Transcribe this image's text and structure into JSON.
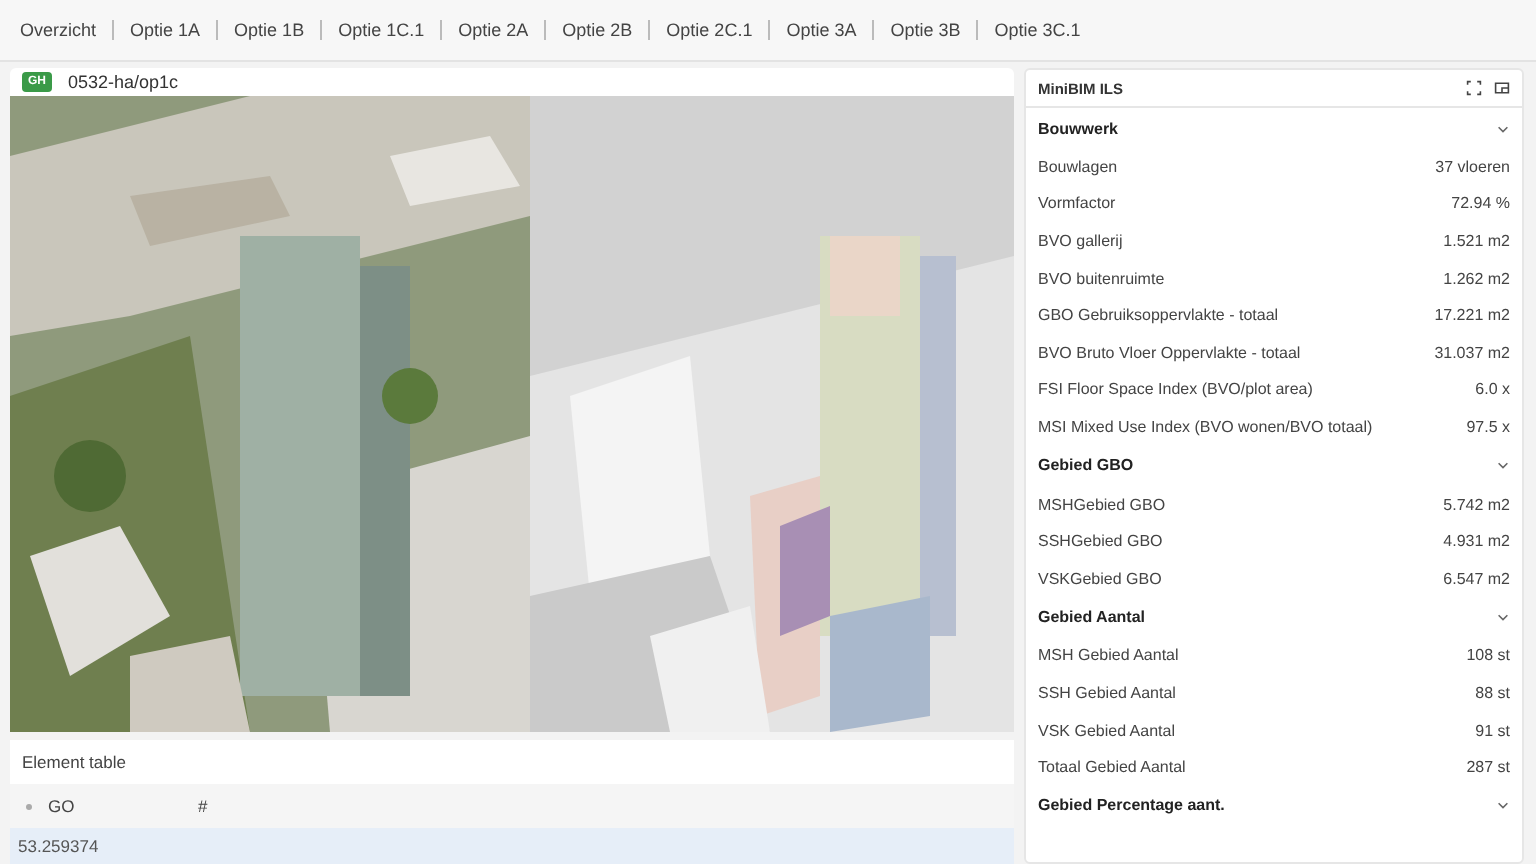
{
  "tabs": [
    {
      "label": "Overzicht"
    },
    {
      "label": "Optie 1A"
    },
    {
      "label": "Optie 1B"
    },
    {
      "label": "Optie 1C.1"
    },
    {
      "label": "Optie 2A"
    },
    {
      "label": "Optie 2B"
    },
    {
      "label": "Optie 2C.1"
    },
    {
      "label": "Optie 3A"
    },
    {
      "label": "Optie 3B"
    },
    {
      "label": "Optie 3C.1"
    }
  ],
  "viewer": {
    "badge": "GH",
    "title": "0532-ha/op1c"
  },
  "element_table": {
    "title": "Element table",
    "columns": [
      "GO",
      "#"
    ],
    "rows": [
      [
        "53.259374"
      ]
    ]
  },
  "panel": {
    "title": "MiniBIM ILS",
    "sections": [
      {
        "title": "Bouwwerk",
        "expanded": true,
        "rows": [
          {
            "label": "Bouwlagen",
            "value": "37 vloeren"
          },
          {
            "label": "Vormfactor",
            "value": "72.94 %"
          },
          {
            "label": "BVO gallerij",
            "value": "1.521 m2"
          },
          {
            "label": "BVO buitenruimte",
            "value": "1.262 m2"
          },
          {
            "label": "GBO Gebruiksoppervlakte - totaal",
            "value": "17.221 m2"
          },
          {
            "label": "BVO Bruto Vloer Oppervlakte - totaal",
            "value": "31.037 m2"
          },
          {
            "label": "FSI Floor Space Index (BVO/plot area)",
            "value": "6.0 x"
          },
          {
            "label": "MSI Mixed Use Index (BVO wonen/BVO totaal)",
            "value": "97.5 x"
          }
        ]
      },
      {
        "title": "Gebied GBO",
        "expanded": true,
        "rows": [
          {
            "label": "MSHGebied GBO",
            "value": "5.742 m2"
          },
          {
            "label": "SSHGebied GBO",
            "value": "4.931 m2"
          },
          {
            "label": "VSKGebied GBO",
            "value": "6.547 m2"
          }
        ]
      },
      {
        "title": "Gebied Aantal",
        "expanded": true,
        "rows": [
          {
            "label": "MSH Gebied Aantal",
            "value": "108 st"
          },
          {
            "label": "SSH Gebied Aantal",
            "value": "88 st"
          },
          {
            "label": "VSK Gebied Aantal",
            "value": "91 st"
          },
          {
            "label": "Totaal Gebied Aantal",
            "value": "287 st"
          }
        ]
      },
      {
        "title": "Gebied Percentage aant.",
        "expanded": true
      }
    ]
  }
}
